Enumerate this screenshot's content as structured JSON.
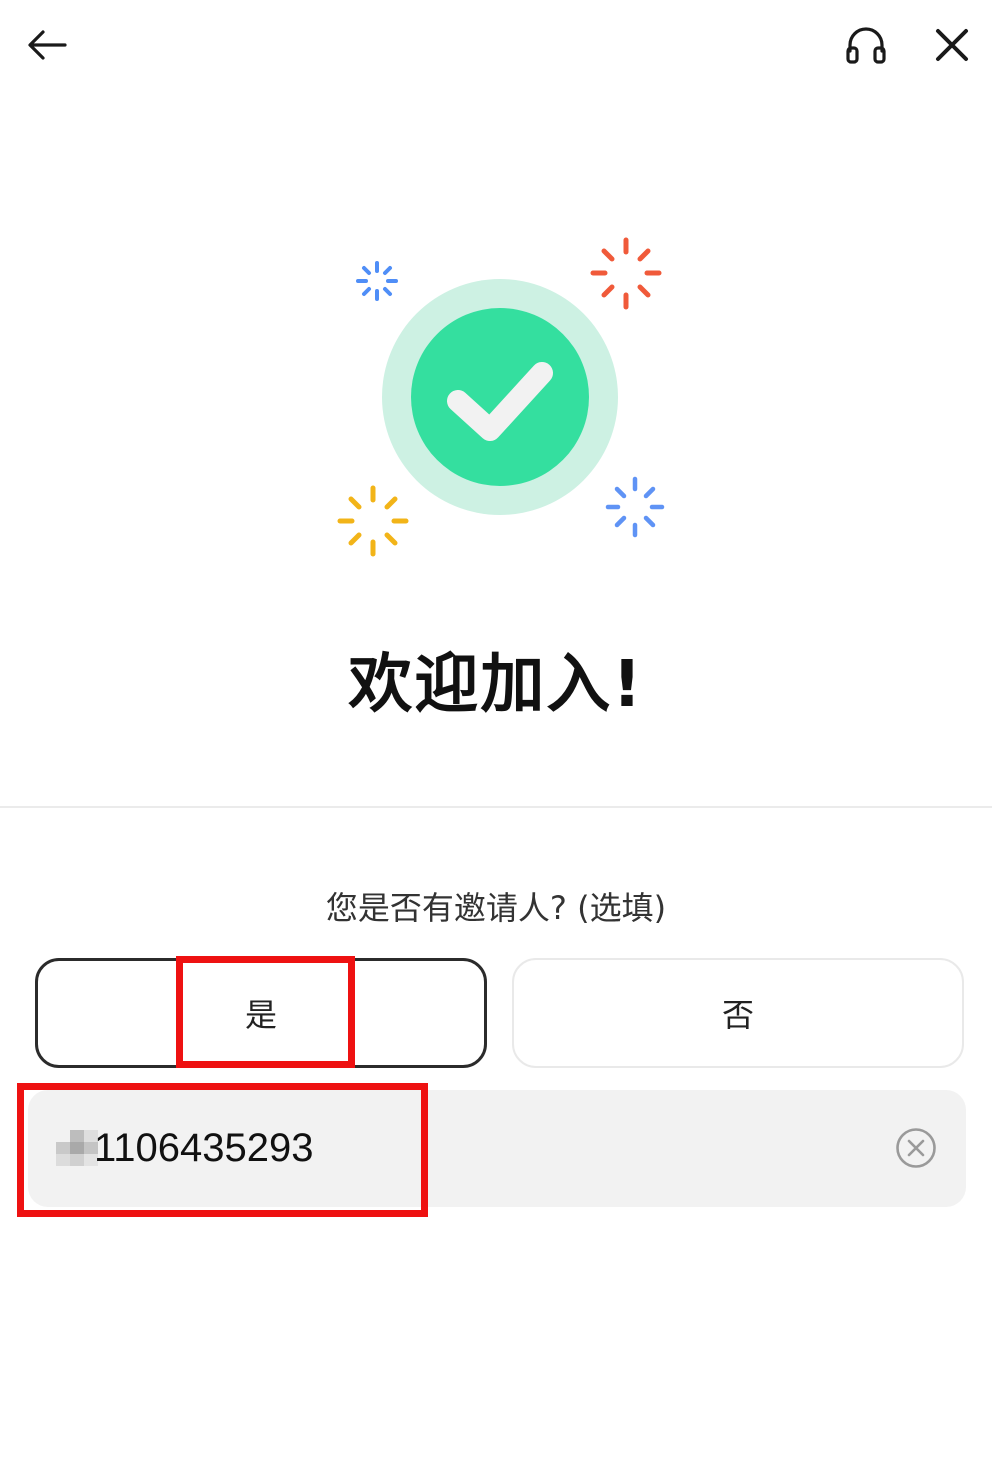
{
  "header": {
    "back_icon": "arrow-left-icon",
    "support_icon": "headset-icon",
    "close_icon": "close-icon"
  },
  "hero": {
    "icon": "check-circle-icon",
    "sparkle_colors": [
      "#4f8ef7",
      "#f05a3a",
      "#f2b418",
      "#5f93f5"
    ],
    "check_color": "#34df9f",
    "halo_color": "#cdf1e3"
  },
  "welcome": {
    "title": "欢迎加入!"
  },
  "inviter": {
    "question": "您是否有邀请人? (选填)",
    "yes_label": "是",
    "no_label": "否",
    "selected": "是",
    "input_value": "1106435293",
    "clear_icon": "clear-circle-icon"
  },
  "colors": {
    "highlight": "#ee1111",
    "selected_border": "#2b2b2b",
    "field_bg": "#f2f2f2"
  }
}
